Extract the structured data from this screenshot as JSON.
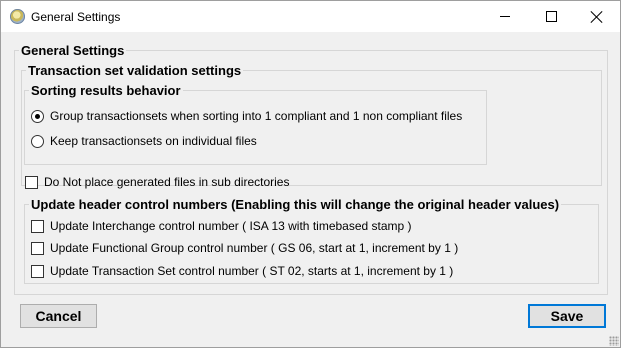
{
  "window": {
    "title": "General Settings",
    "icon": "settings-app-icon",
    "controls": {
      "minimize": "minimize-icon",
      "maximize": "maximize-icon",
      "close": "close-icon"
    }
  },
  "general_settings": {
    "legend": "General Settings",
    "transaction_validation": {
      "legend": "Transaction set validation settings",
      "sorting": {
        "legend": "Sorting results behavior",
        "options": [
          {
            "label": "Group transactionsets when sorting into 1 compliant and 1 non compliant files",
            "selected": true
          },
          {
            "label": "Keep transactionsets on individual files",
            "selected": false
          }
        ]
      }
    },
    "no_subdirs": {
      "label": "Do Not place generated files in sub directories",
      "checked": false
    },
    "header_control": {
      "legend": "Update header control numbers (Enabling this will change the original header values)",
      "options": [
        {
          "label": "Update Interchange control number ( ISA 13 with timebased stamp )",
          "checked": false
        },
        {
          "label": "Update Functional Group control number ( GS 06, start at 1, increment by 1 )",
          "checked": false
        },
        {
          "label": "Update Transaction Set control number ( ST 02, starts at 1, increment by 1 )",
          "checked": false
        }
      ]
    }
  },
  "buttons": {
    "cancel": "Cancel",
    "save": "Save"
  },
  "colors": {
    "default_button_border": "#0078d7"
  }
}
